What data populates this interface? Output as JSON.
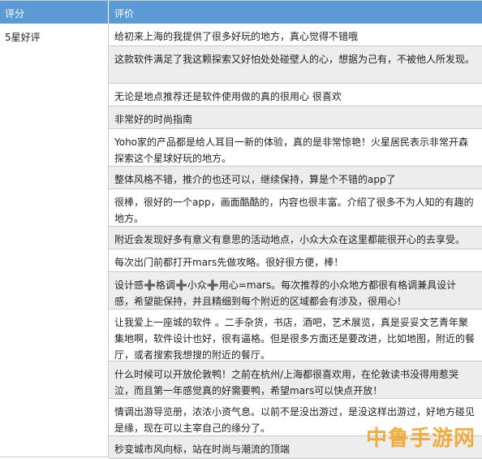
{
  "table": {
    "header_score": "评分",
    "header_review": "评价",
    "score_value": "5星好评",
    "reviews": [
      "给初来上海的我提供了很多好玩的地方，真心觉得不错哦",
      "这款软件满足了我这颗探索又好怕处处碰壁人的心，想据为己有，不被他人所发现。",
      "无论是地点推荐还是软件使用做的真的很用心 很喜欢",
      "非常好的时尚指南",
      "Yoho家的产品都是给人耳目一新的体验，真的是非常惊艳！火星居民表示非常开森探索这个星球好玩的地方。",
      "整体风格不错，推介的也还可以，继续保持，算是个不错的app了",
      "很棒，很好的一个app，画面酷酷的，内容也很丰富。介绍了很多不为人知的有趣的地方。",
      "附近会发现好多有意义有意思的活动地点，小众大众在这里都能很开心的去享受。",
      "每次出门前都打开mars先做攻略。很好很方便，棒！",
      "设计感➕格调➕小众➕用心=mars。每次推荐的小众地方都很有格调兼具设计感，希望能保持，并且精细到每个附近的区域都会有涉及，很用心！",
      "让我爱上一座城的软件 。二手杂货，书店，酒吧，艺术展览，真是妥妥文艺青年聚集地啊，软件设计也好，很有逼格。但是很多方面还是要改进，比如地图，附近的餐厅，或者搜索我想搜的附近的餐厅。",
      "什么时候可以开放伦敦鸭！之前在杭州/上海都很喜欢用，在伦敦读书没得用惹哭泣，而且第一年感觉真的好需要鸭，希望mars可以快点开放！",
      "情调出游导览册，浓浓小资气息。以前不是没出游过，是没这样出游过，好地方碰见是缘，现在可以主宰自己的缘分了。",
      "秒变城市风向标，站在时尚与潮流的顶端"
    ]
  },
  "watermark": "中鲁手游网"
}
